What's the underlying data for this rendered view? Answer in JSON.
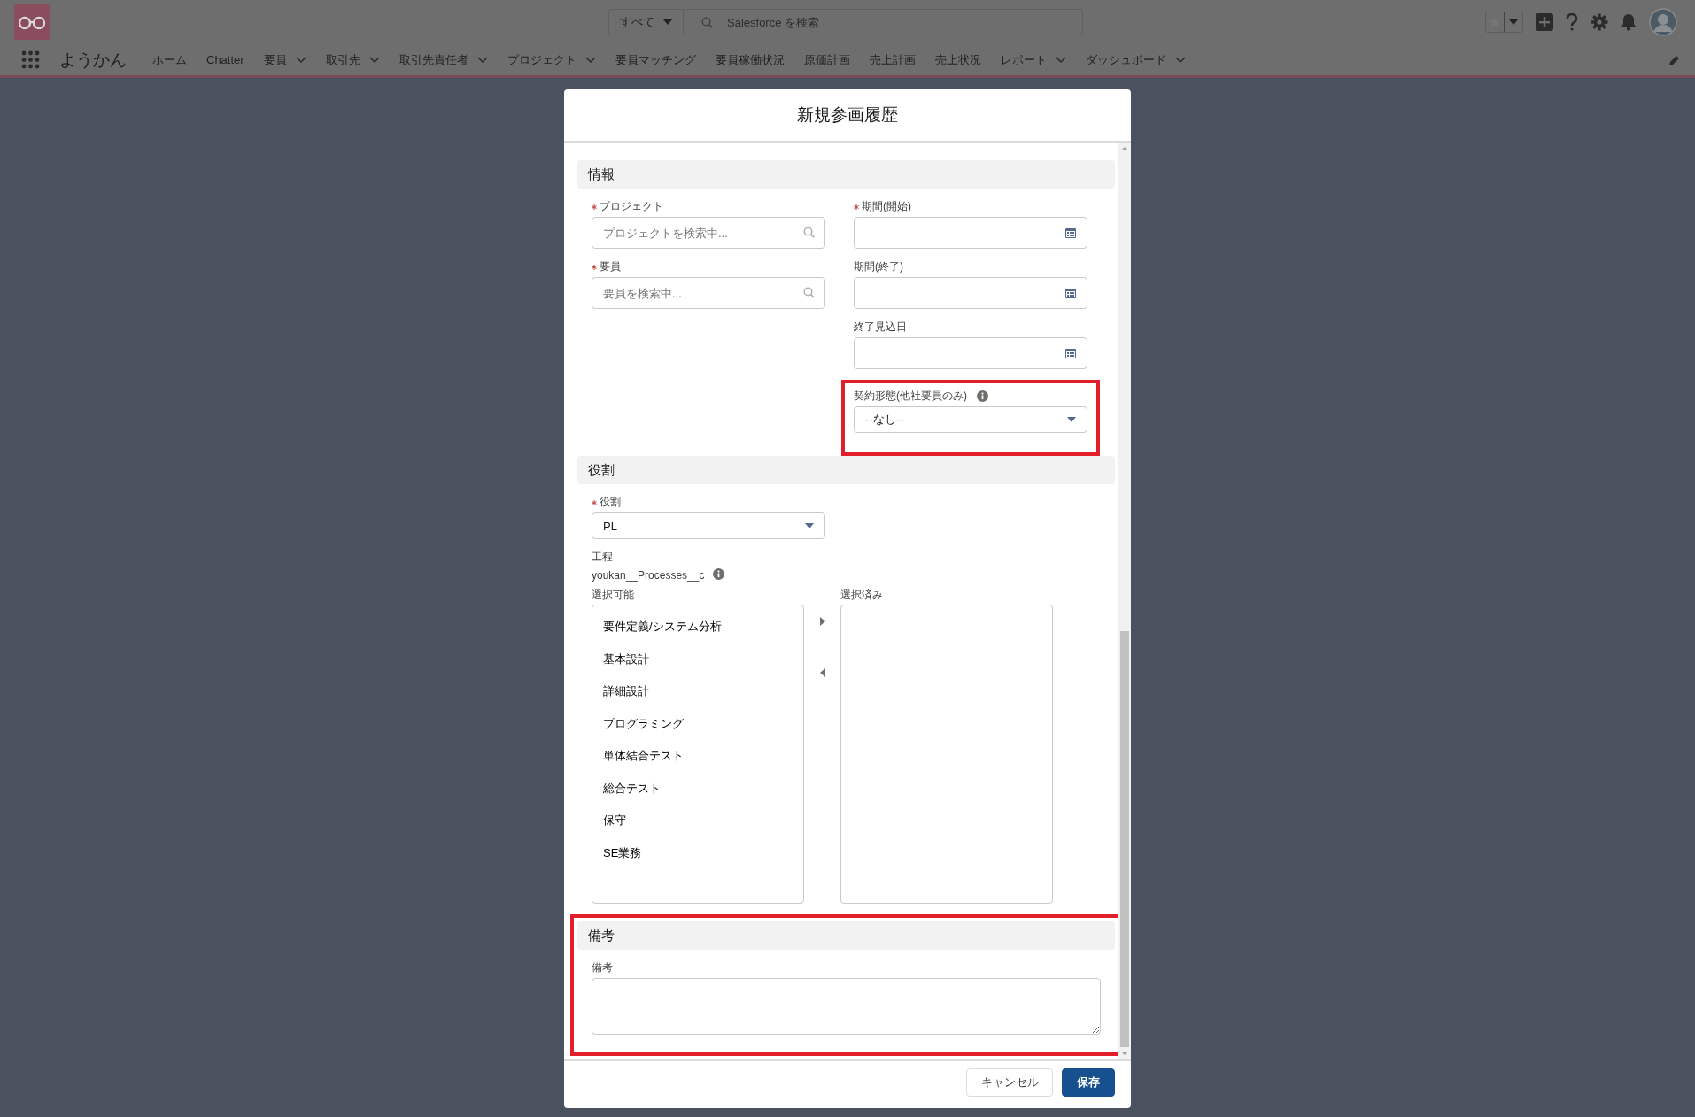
{
  "header": {
    "search": {
      "scope": "すべて",
      "placeholder": "Salesforce を検索"
    },
    "app_name": "ようかん",
    "nav": [
      {
        "label": "ホーム",
        "dropdown": false
      },
      {
        "label": "Chatter",
        "dropdown": false
      },
      {
        "label": "要員",
        "dropdown": true
      },
      {
        "label": "取引先",
        "dropdown": true
      },
      {
        "label": "取引先責任者",
        "dropdown": true
      },
      {
        "label": "プロジェクト",
        "dropdown": true
      },
      {
        "label": "要員マッチング",
        "dropdown": false
      },
      {
        "label": "要員稼働状況",
        "dropdown": false
      },
      {
        "label": "原価計画",
        "dropdown": false
      },
      {
        "label": "売上計画",
        "dropdown": false
      },
      {
        "label": "売上状況",
        "dropdown": false
      },
      {
        "label": "レポート",
        "dropdown": true
      },
      {
        "label": "ダッシュボード",
        "dropdown": true
      }
    ]
  },
  "modal": {
    "title": "新規参画履歴",
    "sections": [
      {
        "title": "情報",
        "highlighted": false,
        "left_fields": [
          {
            "kind": "lookup",
            "label": "プロジェクト",
            "required": true,
            "placeholder": "プロジェクトを検索中..."
          },
          {
            "kind": "lookup",
            "label": "要員",
            "required": true,
            "placeholder": "要員を検索中..."
          }
        ],
        "right_fields": [
          {
            "kind": "date",
            "label": "期間(開始)",
            "required": true
          },
          {
            "kind": "date",
            "label": "期間(終了)",
            "required": false
          },
          {
            "kind": "date",
            "label": "終了見込日",
            "required": false
          },
          {
            "kind": "picklist",
            "label": "契約形態(他社要員のみ)",
            "required": false,
            "info": true,
            "value": "--なし--",
            "highlighted": true
          }
        ]
      },
      {
        "title": "役割",
        "highlighted": false,
        "left_fields": [
          {
            "kind": "picklist",
            "label": "役割",
            "required": true,
            "value": "PL"
          },
          {
            "kind": "dual_listbox",
            "label": "工程",
            "api_name": "youkan__Processes__c",
            "info": true,
            "available_label": "選択可能",
            "selected_label": "選択済み",
            "options": [
              "要件定義/システム分析",
              "基本設計",
              "詳細設計",
              "プログラミング",
              "単体結合テスト",
              "総合テスト",
              "保守",
              "SE業務"
            ]
          }
        ]
      },
      {
        "title": "備考",
        "highlighted": true,
        "left_fields": [
          {
            "kind": "textarea",
            "label": "備考"
          }
        ]
      }
    ],
    "buttons": [
      {
        "label": "キャンセル",
        "kind": "neutral"
      },
      {
        "label": "保存",
        "kind": "brand"
      }
    ]
  }
}
